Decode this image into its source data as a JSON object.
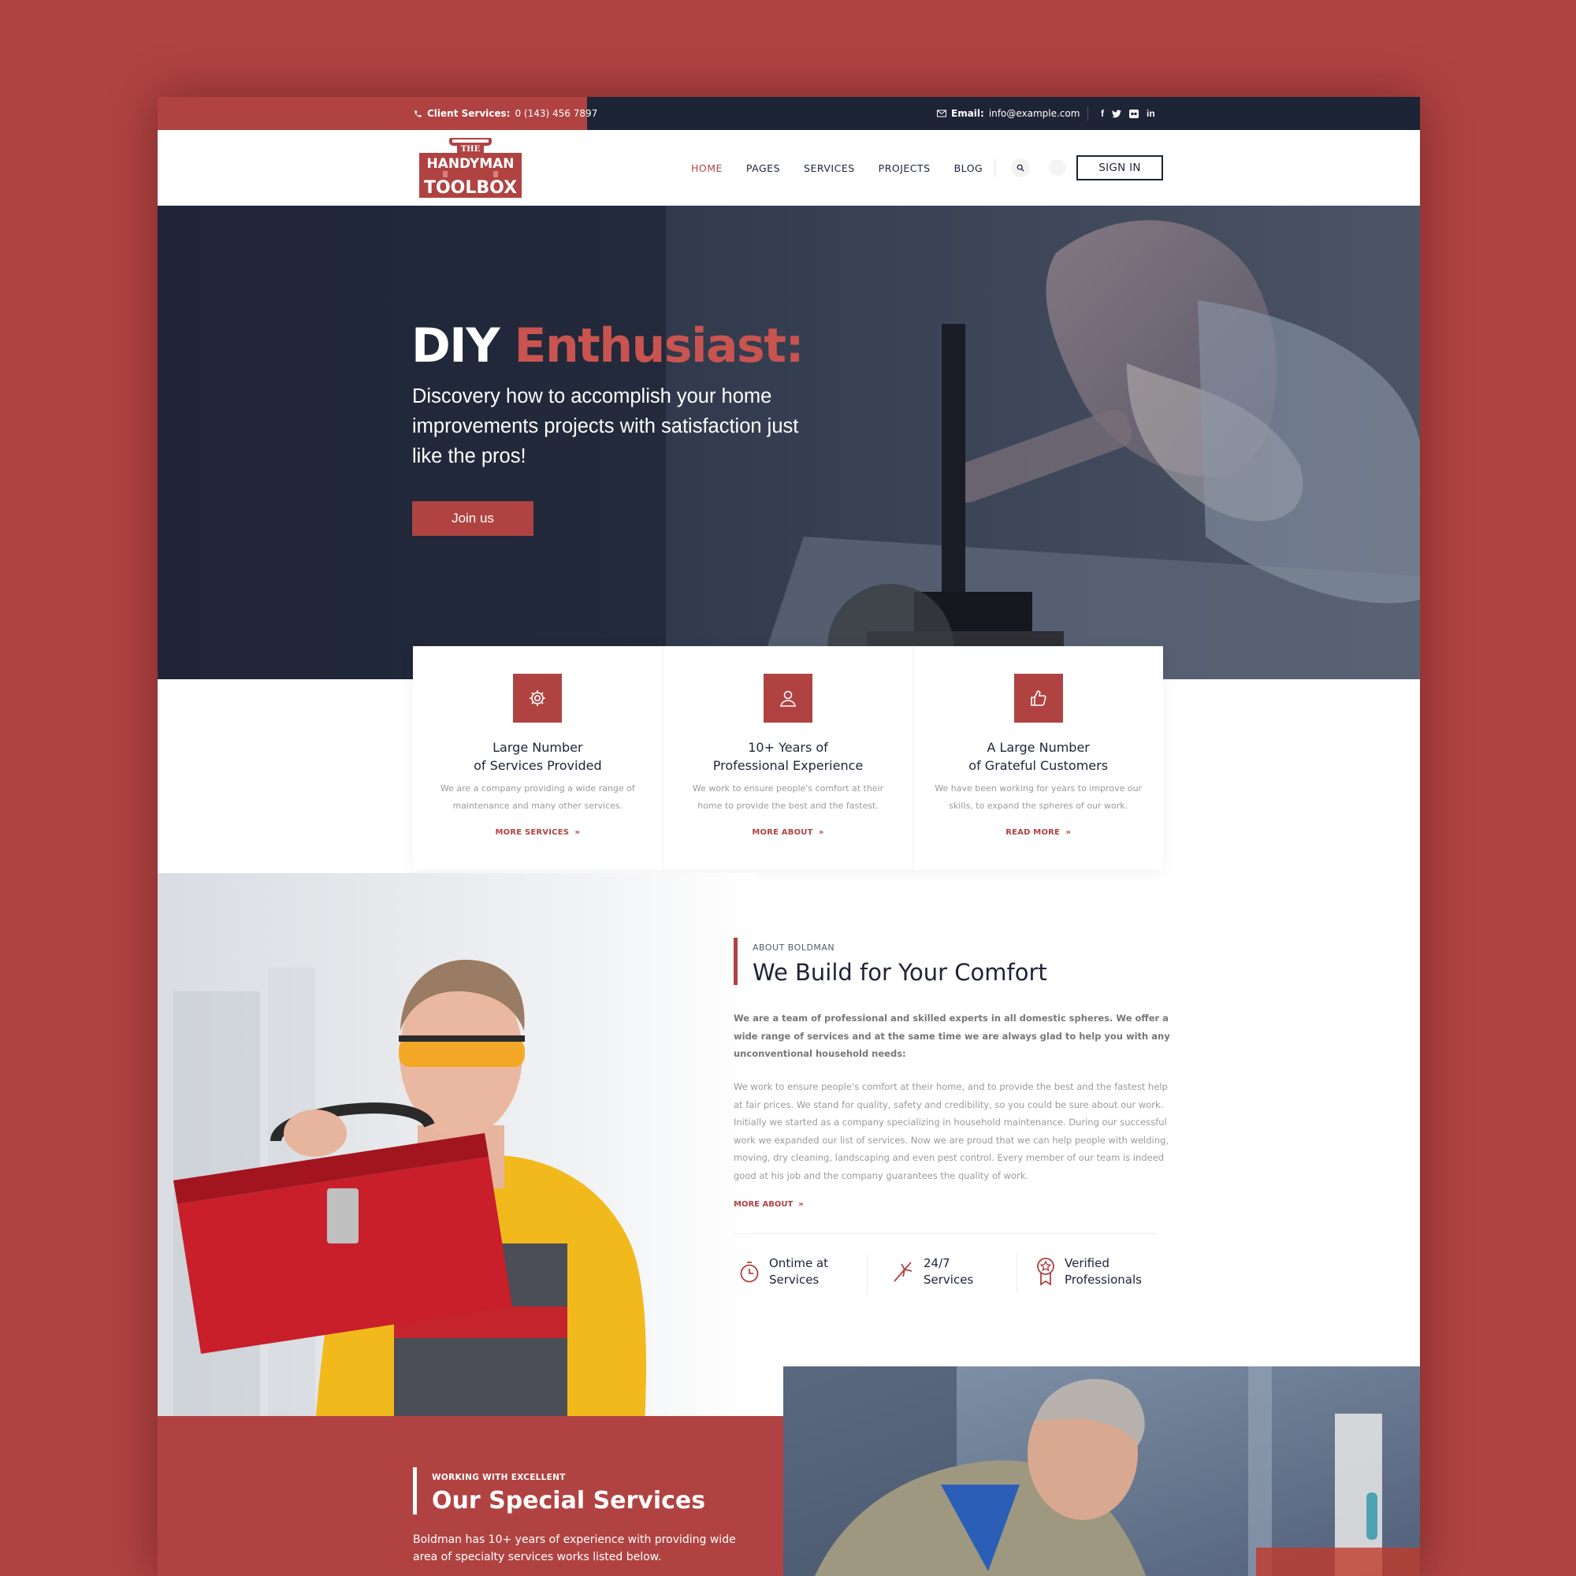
{
  "topbar": {
    "phone_label": "Client Services:",
    "phone_number": "0 (143) 456 7897",
    "email_label": "Email:",
    "email_value": "info@example.com",
    "socials": [
      "f",
      "t",
      "v",
      "in"
    ]
  },
  "header": {
    "logo_top": "THE",
    "logo_mid": "HANDYMAN",
    "logo_bottom": "TOOLBOX",
    "nav": [
      "HOME",
      "PAGES",
      "SERVICES",
      "PROJECTS",
      "BLOG"
    ],
    "signin_label": "SIGN IN"
  },
  "hero": {
    "title_white": "DIY",
    "title_accent": "Enthusiast:",
    "subtitle": "Discovery how to accomplish your home improvements projects with satisfaction just like the pros!",
    "cta": "Join us"
  },
  "features": [
    {
      "icon": "gear-icon",
      "title_line1": "Large Number",
      "title_line2": "of Services Provided",
      "text": "We are a company providing a wide range of maintenance and many other services.",
      "link": "MORE SERVICES"
    },
    {
      "icon": "user-icon",
      "title_line1": "10+ Years of",
      "title_line2": "Professional Experience",
      "text": "We work to ensure people's comfort at their home to provide the best and the fastest.",
      "link": "MORE ABOUT"
    },
    {
      "icon": "thumbs-up-icon",
      "title_line1": "A Large Number",
      "title_line2": "of Grateful Customers",
      "text": "We have been working for years to improve our skills, to expand the spheres of our work.",
      "link": "READ MORE"
    }
  ],
  "about": {
    "eyebrow": "ABOUT BOLDMAN",
    "title": "We Build for Your Comfort",
    "lead": "We are a team of professional and skilled experts in all domestic spheres. We offer a wide range of services and at the same time we are always glad to help you with any unconventional household needs:",
    "body": "We work to ensure people's comfort at their home, and to provide the best and the fastest help at fair prices. We stand for quality, safety and credibility, so you could be sure about our work. Initially we started as a company specializing in household maintenance. During our successful work we expanded our list of services. Now we are proud that we can help people with welding, moving, dry cleaning, landscaping and even pest control. Every member of our team is indeed good at his job and the company guarantees the quality of work.",
    "more": "MORE ABOUT",
    "stats": [
      {
        "icon": "clock-icon",
        "line1": "Ontime at",
        "line2": "Services"
      },
      {
        "icon": "spark-icon",
        "line1": "24/7",
        "line2": "Services"
      },
      {
        "icon": "award-icon",
        "line1": "Verified",
        "line2": "Professionals"
      }
    ]
  },
  "services": {
    "eyebrow": "WORKING WITH EXCELLENT",
    "title": "Our Special Services",
    "text": "Boldman has 10+ years of experience with providing wide area of specialty services works listed below."
  },
  "colors": {
    "brand_red": "#b04342",
    "navy": "#1d2436",
    "accent_text": "#c9544f"
  }
}
